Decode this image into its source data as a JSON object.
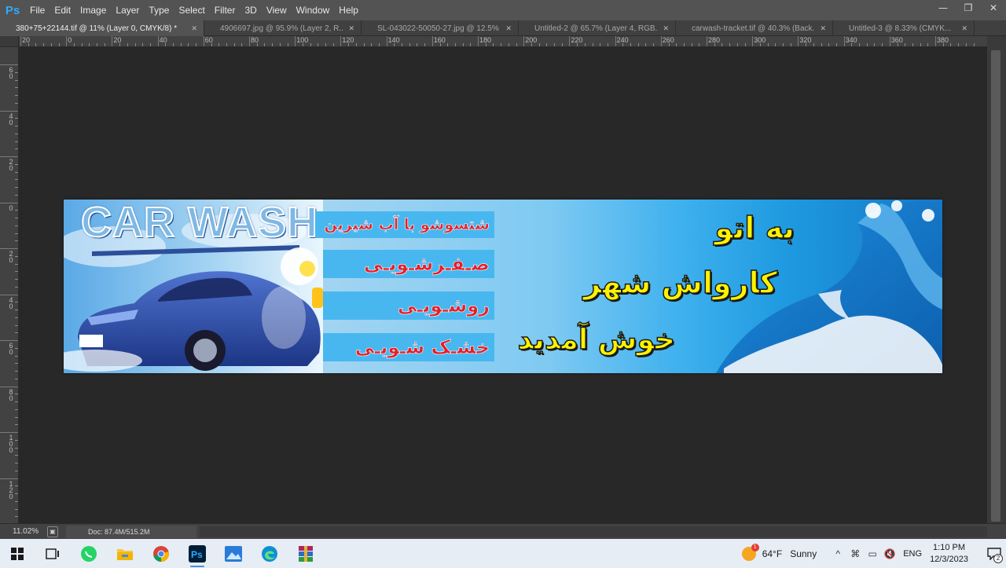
{
  "app": {
    "logo": "Ps",
    "brand_color": "#31a8ff"
  },
  "menu": [
    "File",
    "Edit",
    "Image",
    "Layer",
    "Type",
    "Select",
    "Filter",
    "3D",
    "View",
    "Window",
    "Help"
  ],
  "window_controls": {
    "minimize": "—",
    "restore": "❐",
    "close": "✕"
  },
  "tabs": [
    {
      "label": "380+75+22144.tif @ 11% (Layer 0, CMYK/8) *",
      "active": true
    },
    {
      "label": "4906697.jpg @ 95.9% (Layer 2, R...",
      "active": false
    },
    {
      "label": "SL-043022-50050-27.jpg @ 12.5% ...",
      "active": false
    },
    {
      "label": "Untitled-2 @ 65.7% (Layer 4, RGB...",
      "active": false
    },
    {
      "label": "carwash-tracket.tif @ 40.3% (Back...",
      "active": false
    },
    {
      "label": "Untitled-3 @ 8.33% (CMYK...",
      "active": false
    }
  ],
  "ruler_top": [
    "20",
    "0",
    "20",
    "40",
    "60",
    "80",
    "100",
    "120",
    "140",
    "160",
    "180",
    "200",
    "220",
    "240",
    "260",
    "280",
    "300",
    "320",
    "340",
    "360",
    "380"
  ],
  "ruler_left": [
    "60",
    "40",
    "20",
    "0",
    "20",
    "40",
    "60",
    "80",
    "100",
    "120"
  ],
  "banner": {
    "logo_text": "CAR WASH",
    "services": [
      "شتسوشو با آب شیرین",
      "صـفـرشـویـی",
      "روشـویـی",
      "خشـک شـویـی"
    ],
    "welcome": [
      "به اتو",
      "کارواش شهر",
      "خوش آمدید"
    ],
    "colors": {
      "service_text": "#e61e28",
      "strip": "#48b7ef",
      "welcome_text": "#fff200",
      "car": "#2b4fa8"
    }
  },
  "status": {
    "zoom": "11.02%",
    "doc": "Doc: 87.4M/515.2M",
    "arrow": "▶"
  },
  "taskbar": {
    "icons": [
      "windows-start-icon",
      "task-view-icon",
      "whatsapp-icon",
      "file-explorer-icon",
      "chrome-icon",
      "photoshop-icon",
      "photos-icon",
      "edge-icon",
      "winrar-icon"
    ],
    "weather": {
      "temp": "64°F",
      "condition": "Sunny",
      "badge": "1"
    },
    "tray_glyphs": [
      "^",
      "⌘",
      "▭",
      "🔇"
    ],
    "language": "ENG",
    "time": "1:10 PM",
    "date": "12/3/2023",
    "notifications": "2"
  }
}
